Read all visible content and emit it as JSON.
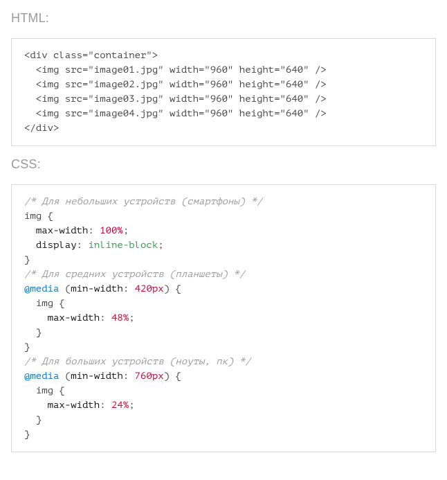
{
  "labels": {
    "html": "HTML:",
    "css": "CSS:"
  },
  "html_block": {
    "line1": "<div class=\"container\">",
    "line2": "  <img src=\"image01.jpg\" width=\"960\" height=\"640\" />",
    "line3": "  <img src=\"image02.jpg\" width=\"960\" height=\"640\" />",
    "line4": "  <img src=\"image03.jpg\" width=\"960\" height=\"640\" />",
    "line5": "  <img src=\"image04.jpg\" width=\"960\" height=\"640\" />",
    "line6": "</div>"
  },
  "css_block": {
    "c1": "/* Для небольших устройств (смартфоны) */",
    "sel1": "img",
    "ob": "{",
    "cb": "}",
    "p_maxwidth": "max-width",
    "p_display": "display",
    "v_100": "100%",
    "v_inline": "inline-block",
    "v_48": "48%",
    "v_24": "24%",
    "colon": ":",
    "semi": ";",
    "c2": "/* Для средних устройств (планшеты) */",
    "media": "@media",
    "minwidth": "min-width",
    "mw420": "420px",
    "mw760": "760px",
    "c3": "/* Для больших устройств (ноуты, пк) */",
    "sp2": "  ",
    "sp4": "    ",
    "paren_o": "(",
    "paren_c": ")"
  }
}
